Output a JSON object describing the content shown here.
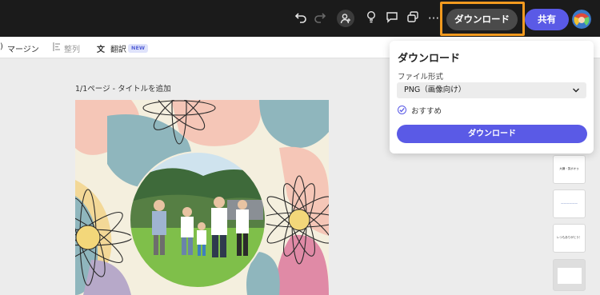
{
  "topbar": {
    "download_label": "ダウンロード",
    "share_label": "共有",
    "undo_icon": "undo-icon",
    "redo_icon": "redo-icon",
    "more_label": "···"
  },
  "toolbar2": {
    "margin_label": "マージン",
    "align_label": "整列",
    "translate_label": "翻訳",
    "new_badge": "NEW"
  },
  "page": {
    "title": "1/1ページ - タイトルを追加"
  },
  "thumbnails": [
    {
      "text": "大嫌・笑ポオゥ"
    },
    {
      "text": "——————"
    },
    {
      "text": "レつもありがとう！"
    },
    {
      "text": ""
    }
  ],
  "download_panel": {
    "title": "ダウンロード",
    "file_format_label": "ファイル形式",
    "file_format_value": "PNG（画像向け）",
    "recommended_label": "おすすめ",
    "download_button": "ダウンロード"
  },
  "colors": {
    "accent": "#5a5ae6",
    "highlight": "#f29a1f",
    "topbar_bg": "#1b1b1b"
  }
}
